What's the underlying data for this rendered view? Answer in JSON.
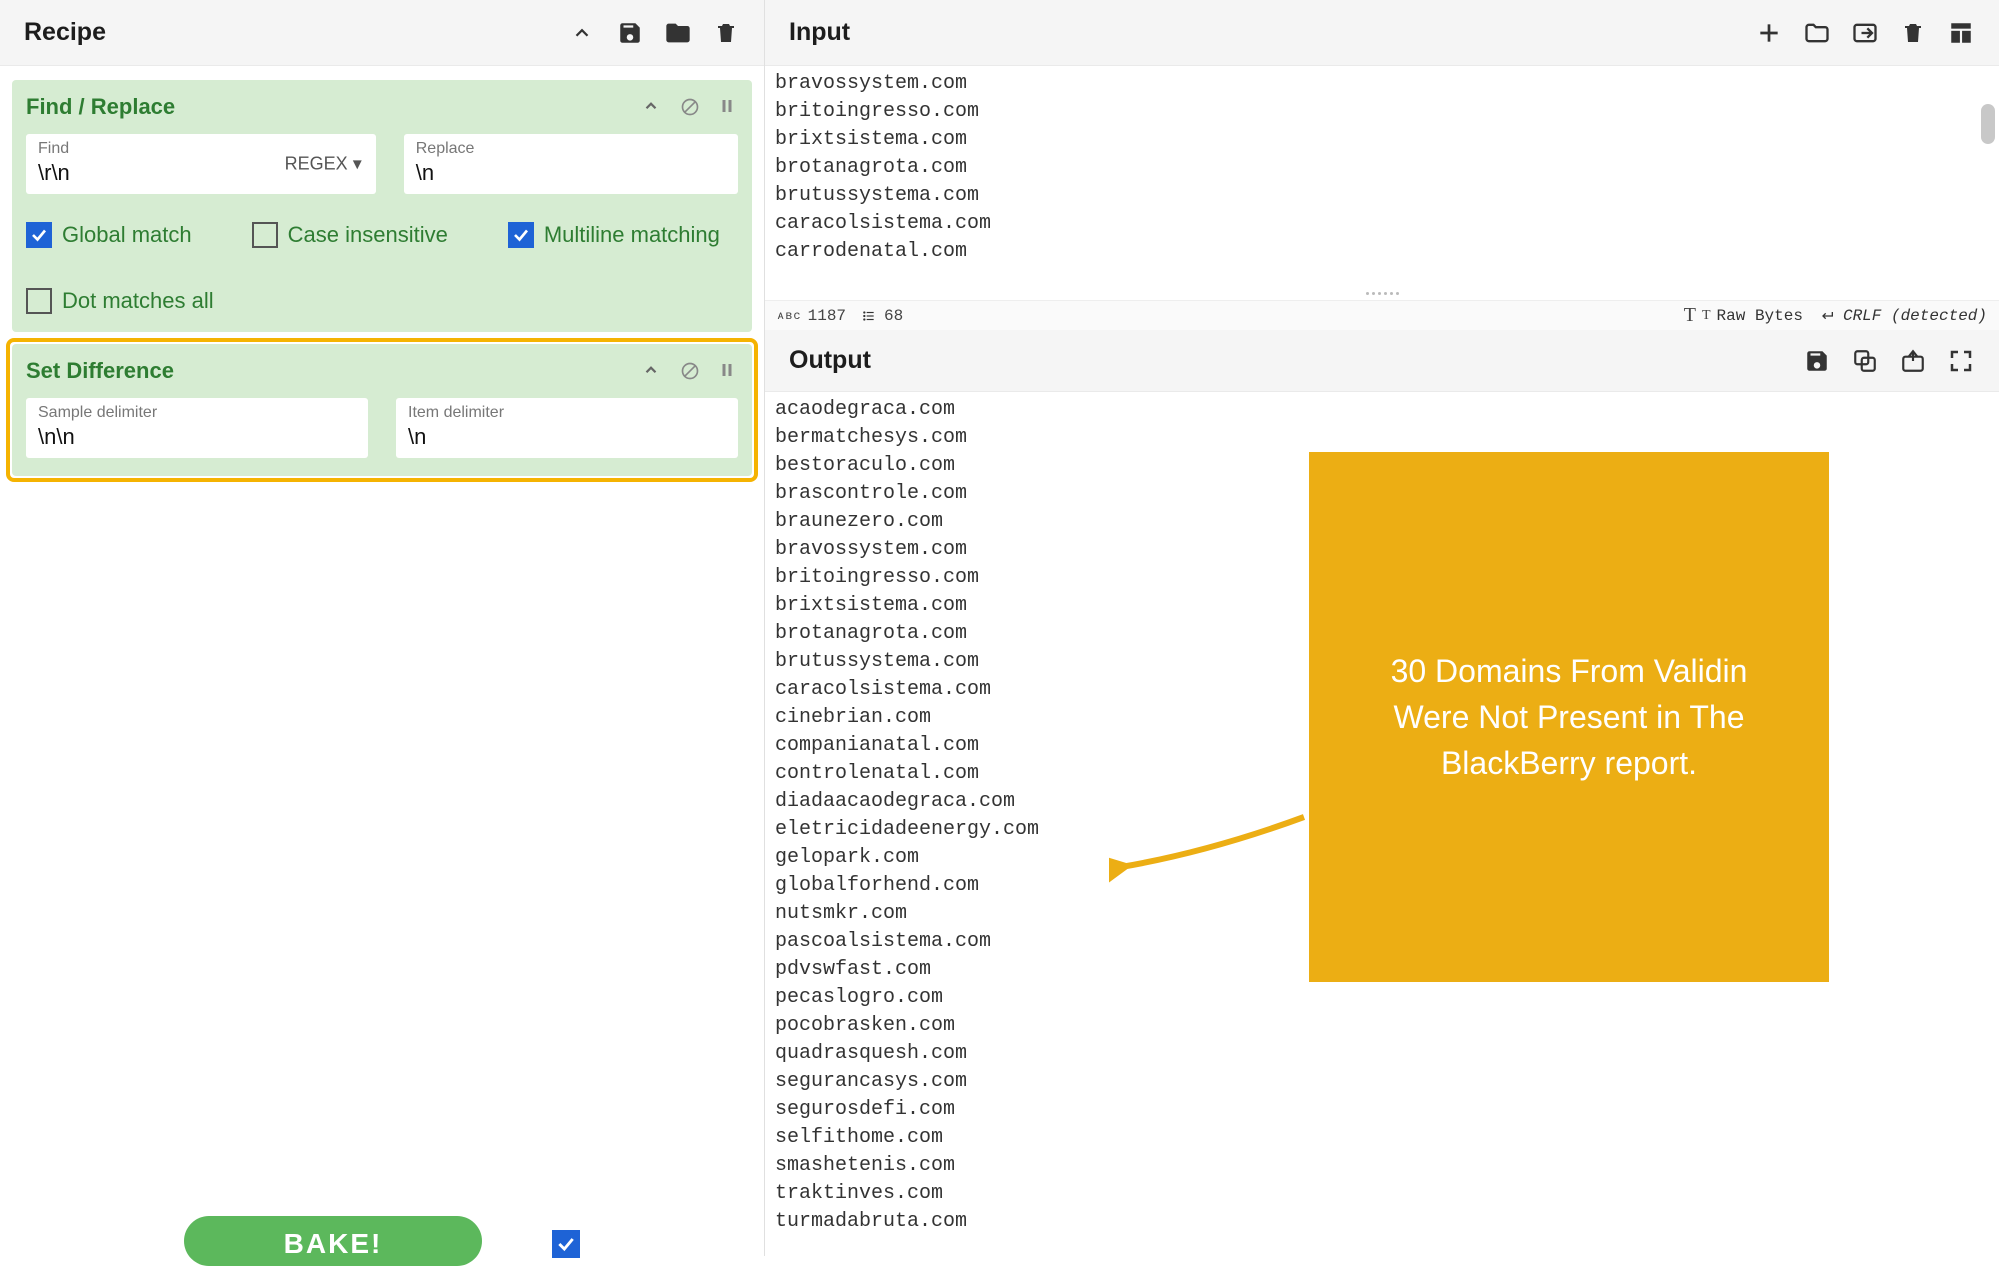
{
  "recipe": {
    "title": "Recipe",
    "operations": [
      {
        "name": "Find / Replace",
        "fields": {
          "find": {
            "label": "Find",
            "value": "\\r\\n",
            "mode": "REGEX"
          },
          "replace": {
            "label": "Replace",
            "value": "\\n"
          }
        },
        "checks": {
          "global": {
            "label": "Global match",
            "on": true
          },
          "case": {
            "label": "Case insensitive",
            "on": false
          },
          "multi": {
            "label": "Multiline matching",
            "on": true
          },
          "dot": {
            "label": "Dot matches all",
            "on": false
          }
        }
      },
      {
        "name": "Set Difference",
        "fields": {
          "sample": {
            "label": "Sample delimiter",
            "value": "\\n\\n"
          },
          "item": {
            "label": "Item delimiter",
            "value": "\\n"
          }
        }
      }
    ],
    "bake_label": "BAKE!"
  },
  "input": {
    "title": "Input",
    "text": "bravossystem.com\nbritoingresso.com\nbrixtsistema.com\nbrotanagrota.com\nbrutussystema.com\ncaracolsistema.com\ncarrodenatal.com",
    "status": {
      "char_count": "1187",
      "line_count": "68",
      "raw_bytes_label": "Raw Bytes",
      "newline_label": "CRLF (detected)"
    }
  },
  "output": {
    "title": "Output",
    "text": "acaodegraca.com\nbermatchesys.com\nbestoraculo.com\nbrascontrole.com\nbraunezero.com\nbravossystem.com\nbritoingresso.com\nbrixtsistema.com\nbrotanagrota.com\nbrutussystema.com\ncaracolsistema.com\ncinebrian.com\ncompanianatal.com\ncontrolenatal.com\ndiadaacaodegraca.com\neletricidadeenergy.com\ngelopark.com\nglobalforhend.com\nnutsmkr.com\npascoalsistema.com\npdvswfast.com\npecaslogro.com\npocobrasken.com\nquadrasquesh.com\nsegurancasys.com\nsegurosdefi.com\nselfithome.com\nsmashetenis.com\ntraktinves.com\nturmadabruta.com"
  },
  "callout": {
    "text": "30 Domains From Validin Were Not Present in The BlackBerry report."
  }
}
